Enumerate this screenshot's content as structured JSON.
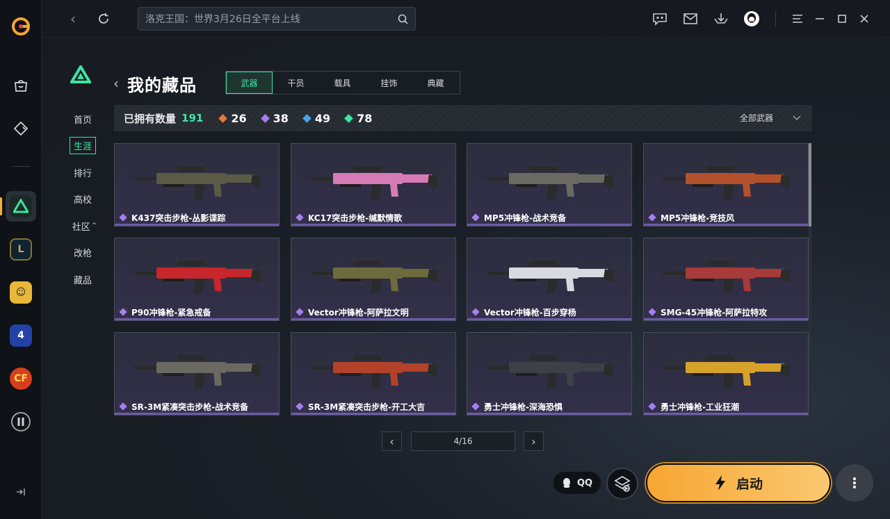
{
  "search": {
    "placeholder": "洛克王国：世界3月26日全平台上线"
  },
  "page": {
    "title": "我的藏品",
    "tabs": [
      {
        "label": "武器",
        "active": true
      },
      {
        "label": "干员",
        "active": false
      },
      {
        "label": "载具",
        "active": false
      },
      {
        "label": "挂饰",
        "active": false
      },
      {
        "label": "典藏",
        "active": false
      }
    ]
  },
  "section_nav": [
    {
      "label": "首页",
      "active": false
    },
    {
      "label": "生涯",
      "active": true
    },
    {
      "label": "排行",
      "active": false
    },
    {
      "label": "高校",
      "active": false
    },
    {
      "label": "社区",
      "active": false,
      "suffix": "^"
    },
    {
      "label": "改枪",
      "active": false
    },
    {
      "label": "藏品",
      "active": false
    }
  ],
  "stats": {
    "owned_label": "已拥有数量",
    "owned_total": "191",
    "tiers": [
      {
        "value": "26",
        "color": "#e07b3a"
      },
      {
        "value": "38",
        "color": "#a77ef2"
      },
      {
        "value": "49",
        "color": "#4aa3e8"
      },
      {
        "value": "78",
        "color": "#3ee4a3"
      }
    ],
    "filter_label": "全部武器"
  },
  "weapons": [
    {
      "name": "K437突击步枪-丛影谍踪",
      "color": "#5a5a46"
    },
    {
      "name": "KC17突击步枪-缄默情歌",
      "color": "#d77bb6"
    },
    {
      "name": "MP5冲锋枪-战术竞备",
      "color": "#6b6a62"
    },
    {
      "name": "MP5冲锋枪-竞技风",
      "color": "#b3512a"
    },
    {
      "name": "P90冲锋枪-紧急戒备",
      "color": "#c7262a"
    },
    {
      "name": "Vector冲锋枪-阿萨拉文明",
      "color": "#6d6a3d"
    },
    {
      "name": "Vector冲锋枪-百步穿杨",
      "color": "#d9d9e0"
    },
    {
      "name": "SMG-45冲锋枪-阿萨拉特攻",
      "color": "#a83a3a"
    },
    {
      "name": "SR-3M紧凑突击步枪-战术竞备",
      "color": "#6b6a62"
    },
    {
      "name": "SR-3M紧凑突击步枪-开工大吉",
      "color": "#b2432a"
    },
    {
      "name": "勇士冲锋枪-深海恐惧",
      "color": "#3e4048"
    },
    {
      "name": "勇士冲锋枪-工业狂潮",
      "color": "#d6a22c"
    }
  ],
  "pagination": {
    "indicator": "4/16"
  },
  "bottom": {
    "qq_label": "QQ",
    "launch_label": "启动"
  },
  "colors": {
    "accent": "#3ee4a3",
    "launch": "#f7a632"
  },
  "icons": {
    "rail": [
      "app-logo-icon",
      "store-icon",
      "game-library-icon",
      "delta-force-icon",
      "league-icon",
      "game-icon-2",
      "game-icon-3",
      "crossfire-icon",
      "pause-icon",
      "collapse-icon"
    ],
    "topbar": [
      "back-icon",
      "refresh-icon",
      "search-icon",
      "chat-icon",
      "mail-icon",
      "download-icon",
      "qq-avatar-icon",
      "menu-icon",
      "minimize-icon",
      "maximize-icon",
      "close-icon"
    ]
  }
}
